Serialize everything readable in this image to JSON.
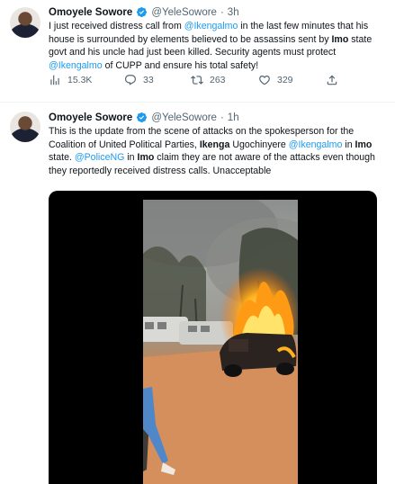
{
  "tweets": [
    {
      "author": "Omoyele Sowore",
      "handle": "@YeleSowore",
      "separator": "·",
      "time": "3h",
      "text": [
        {
          "t": "I just received distress call from ",
          "s": "plain"
        },
        {
          "t": "@Ikengalmo",
          "s": "mention"
        },
        {
          "t": " in the last few minutes that his house is surrounded by elements believed to be assassins sent by ",
          "s": "plain"
        },
        {
          "t": "Imo",
          "s": "bold"
        },
        {
          "t": " state govt and his uncle had just been killed. Security agents must protect ",
          "s": "plain"
        },
        {
          "t": "@Ikengalmo",
          "s": "mention"
        },
        {
          "t": " of CUPP and ensure his total safety!",
          "s": "plain"
        }
      ],
      "stats": {
        "views": "15.3K",
        "replies": "33",
        "retweets": "263",
        "likes": "329"
      }
    },
    {
      "author": "Omoyele Sowore",
      "handle": "@YeleSowore",
      "separator": "·",
      "time": "1h",
      "text": [
        {
          "t": "This is the update from the scene of attacks on the spokesperson for the Coalition of United Political Parties, ",
          "s": "plain"
        },
        {
          "t": "Ikenga",
          "s": "bold"
        },
        {
          "t": " Ugochinyere ",
          "s": "plain"
        },
        {
          "t": "@Ikengalmo",
          "s": "mention"
        },
        {
          "t": " in ",
          "s": "plain"
        },
        {
          "t": "Imo",
          "s": "bold"
        },
        {
          "t": " state. ",
          "s": "plain"
        },
        {
          "t": "@PoliceNG",
          "s": "mention"
        },
        {
          "t": " in ",
          "s": "plain"
        },
        {
          "t": "Imo",
          "s": "bold"
        },
        {
          "t": " claim they are not aware of the attacks even though they reportedly received distress calls. Unacceptable",
          "s": "plain"
        }
      ]
    }
  ],
  "colors": {
    "accent": "#1d9bf0",
    "muted": "#536471",
    "text": "#0f1419",
    "divider": "#eff3f4"
  },
  "icons": [
    "verified-badge-icon",
    "views-icon",
    "reply-icon",
    "retweet-icon",
    "like-icon",
    "share-icon"
  ]
}
